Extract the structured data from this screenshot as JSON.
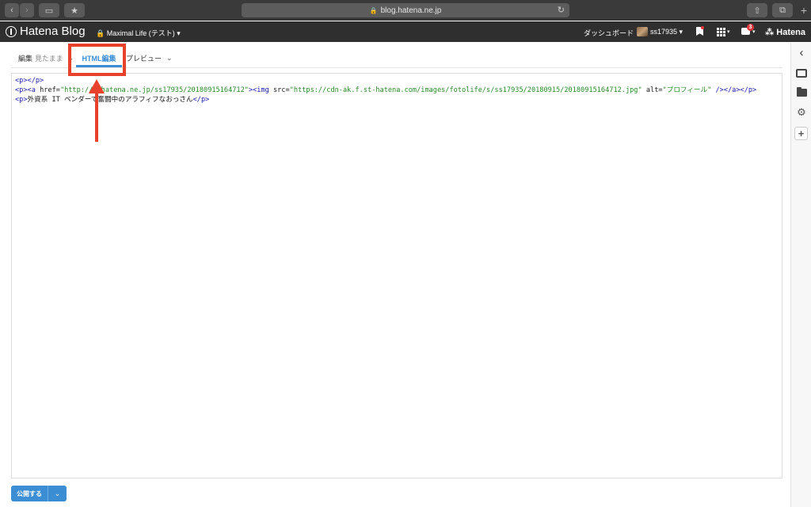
{
  "browser": {
    "url": "blog.hatena.ne.jp",
    "back_icon": "‹",
    "forward_icon": "›",
    "sidebar_icon": "▭",
    "bookmark_icon": "★",
    "reload_icon": "↻",
    "share_icon": "⇧",
    "tabs_icon": "⧉",
    "new_tab_icon": "+"
  },
  "header": {
    "logo_text": "Hatena Blog",
    "blog_select": "🔒 Maximal Life (テスト) ▾",
    "dashboard": "ダッシュボード",
    "user": "ss17935 ▾",
    "notifications_count": "3",
    "grid_caret": "▾",
    "notif_caret": "▾",
    "hatena": "⁂ Hatena"
  },
  "tabs": {
    "edit_label": "編集",
    "edit_sub": "見たまま",
    "edit_chev": "⌄",
    "html_label": "HTML編集",
    "preview_label": "プレビュー",
    "preview_chev": "⌄"
  },
  "editor": {
    "line1": {
      "open": "<p>",
      "text": "",
      "close": "</p>"
    },
    "line2": {
      "p_open": "<p>",
      "a_open": "<a",
      "href_attr": " href=",
      "href_val": "\"http://f.hatena.ne.jp/ss17935/20180915164712\"",
      "gt": ">",
      "img_open": "<img",
      "src_attr": " src=",
      "src_val": "\"https://cdn-ak.f.st-hatena.com/images/fotolife/s/ss17935/20180915/20180915164712.jpg\"",
      "alt_attr": " alt=",
      "alt_val": "\"プロフィール\"",
      "img_close": " />",
      "a_close": "</a>",
      "p_close": "</p>"
    },
    "line3": {
      "open": "<p>",
      "text": "外資系 IT ベンダーで奮闘中のアラフィフなおっさん",
      "close": "</p>"
    }
  },
  "sidebar": {
    "collapse_icon": "‹",
    "gear_icon": "⚙",
    "plus_icon": "+"
  },
  "publish": {
    "label": "公開する",
    "caret": "⌄"
  },
  "colors": {
    "accent": "#3b8ed4",
    "annotation": "#e8412c",
    "header_bg": "#2f2f2f"
  }
}
